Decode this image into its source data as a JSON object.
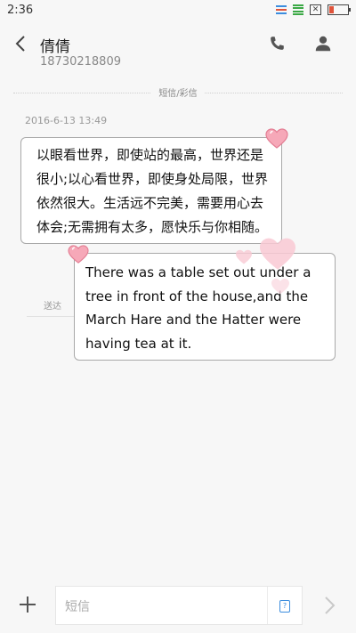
{
  "status_bar": {
    "time": "2:36",
    "battery_level": 0.22
  },
  "header": {
    "contact_name": "倩倩",
    "contact_number": "18730218809",
    "icons": [
      "back-arrow-icon",
      "phone-icon",
      "person-icon"
    ]
  },
  "thread": {
    "divider_label": "短信/彩信",
    "timestamp": "2016-6-13 13:49",
    "incoming": {
      "lines": [
        "以眼看世界，即使站的最高，世界还是",
        "很小;以心看世界，即使身处局限，世界",
        "依然很大。生活远不完美，需要用心去",
        "体会;无需拥有太多，愿快乐与你相随。"
      ]
    },
    "outgoing": {
      "status": "送达",
      "lines": [
        "There was a table set out under a",
        "tree in front of the house,and the",
        "March Hare and the Hatter were",
        "having tea at it."
      ]
    }
  },
  "composer": {
    "placeholder": "短信",
    "icons": [
      "plus-icon",
      "sim-card-icon",
      "send-icon"
    ]
  },
  "colors": {
    "background": "#f7f7f7",
    "bubble_border": "#a9a9a9",
    "heart_pink": "#f38aa0",
    "accent_blue": "#3c8dde"
  }
}
